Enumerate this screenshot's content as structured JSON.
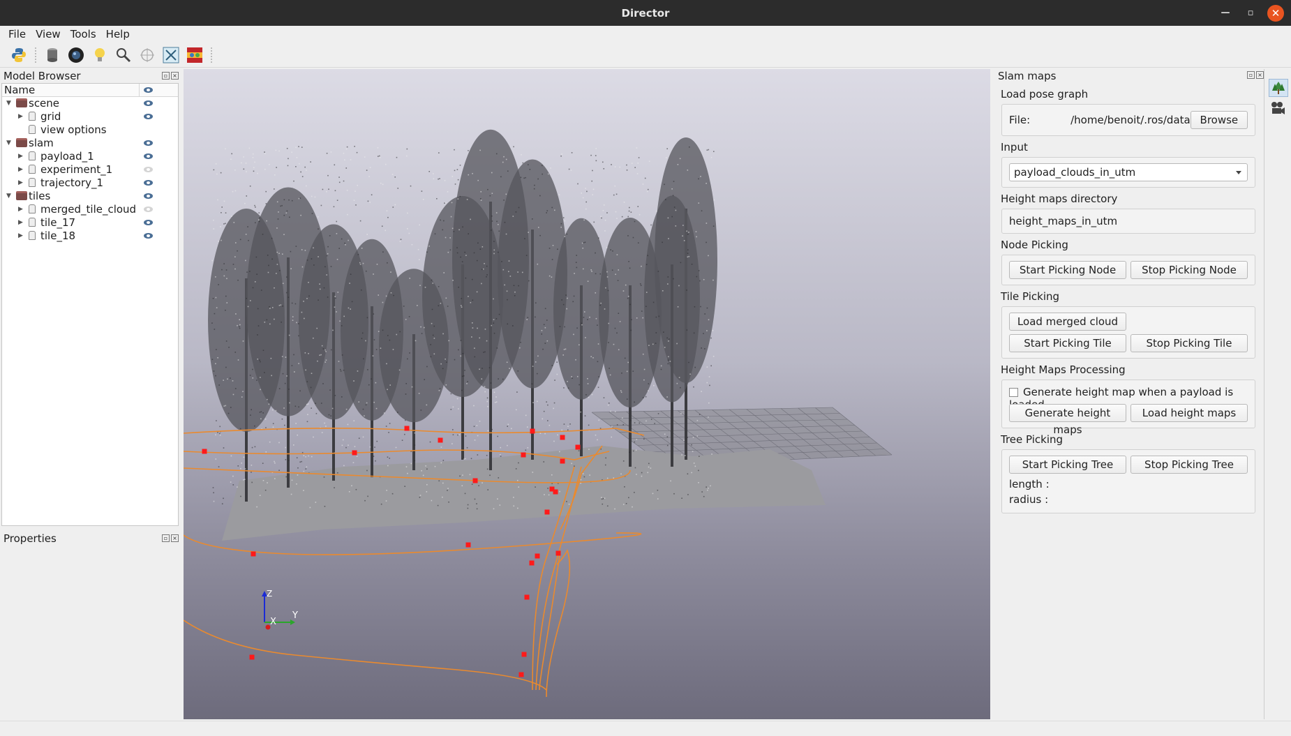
{
  "window": {
    "title": "Director"
  },
  "menu": [
    "File",
    "View",
    "Tools",
    "Help"
  ],
  "toolbar": {
    "icons": [
      "python-icon",
      "database-icon",
      "camera-lens-icon",
      "lightbulb-icon",
      "magnifier-icon",
      "crosshair-icon",
      "fit-view-icon",
      "colormap-icon"
    ]
  },
  "model_browser": {
    "title": "Model Browser",
    "column_name": "Name",
    "rows": [
      {
        "label": "scene",
        "level": 0,
        "type": "folder",
        "expanded": true,
        "visible": true
      },
      {
        "label": "grid",
        "level": 1,
        "type": "object",
        "expandable": true,
        "visible": true
      },
      {
        "label": "view options",
        "level": 1,
        "type": "object",
        "expandable": false,
        "visible": null
      },
      {
        "label": "slam",
        "level": 0,
        "type": "folder",
        "expanded": true,
        "visible": true
      },
      {
        "label": "payload_1",
        "level": 1,
        "type": "object",
        "expandable": true,
        "visible": true
      },
      {
        "label": "experiment_1",
        "level": 1,
        "type": "object",
        "expandable": true,
        "visible": false
      },
      {
        "label": "trajectory_1",
        "level": 1,
        "type": "object",
        "expandable": true,
        "visible": true
      },
      {
        "label": "tiles",
        "level": 0,
        "type": "folder",
        "expanded": true,
        "visible": true
      },
      {
        "label": "merged_tile_cloud",
        "level": 1,
        "type": "object",
        "expandable": true,
        "visible": false
      },
      {
        "label": "tile_17",
        "level": 1,
        "type": "object",
        "expandable": true,
        "visible": true
      },
      {
        "label": "tile_18",
        "level": 1,
        "type": "object",
        "expandable": true,
        "visible": true
      }
    ]
  },
  "properties": {
    "title": "Properties"
  },
  "axes_labels": {
    "x": "X",
    "y": "Y",
    "z": "Z"
  },
  "slam_panel": {
    "title": "Slam maps",
    "load_pose_graph": {
      "label": "Load pose graph",
      "file_label": "File:",
      "file_value": "/home/benoit/.ros/data",
      "browse": "Browse"
    },
    "input": {
      "label": "Input",
      "selected": "payload_clouds_in_utm"
    },
    "height_maps_dir": {
      "label": "Height maps directory",
      "value": "height_maps_in_utm"
    },
    "node_picking": {
      "label": "Node Picking",
      "start": "Start Picking Node",
      "stop": "Stop Picking Node"
    },
    "tile_picking": {
      "label": "Tile Picking",
      "load": "Load merged cloud",
      "start": "Start Picking Tile",
      "stop": "Stop Picking Tile"
    },
    "height_maps_processing": {
      "label": "Height Maps Processing",
      "checkbox": "Generate height map when a payload is loaded",
      "checked": false,
      "generate": "Generate height maps",
      "load": "Load height maps"
    },
    "tree_picking": {
      "label": "Tree Picking",
      "start": "Start Picking Tree",
      "stop": "Stop Picking Tree",
      "length": "length :",
      "radius": "radius :"
    }
  },
  "side_strip": {
    "icons": [
      "tree-icon",
      "movie-camera-icon"
    ]
  }
}
